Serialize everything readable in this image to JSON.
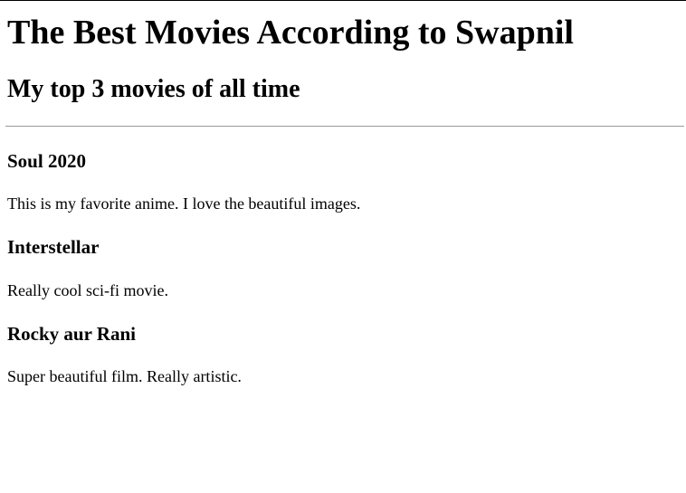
{
  "page": {
    "title": "The Best Movies According to Swapnil",
    "subtitle": "My top 3 movies of all time"
  },
  "movies": [
    {
      "name": "Soul 2020",
      "description": "This is my favorite anime. I love the beautiful images."
    },
    {
      "name": "Interstellar",
      "description": "Really cool sci-fi movie."
    },
    {
      "name": "Rocky aur Rani",
      "description": "Super beautiful film. Really artistic."
    }
  ]
}
